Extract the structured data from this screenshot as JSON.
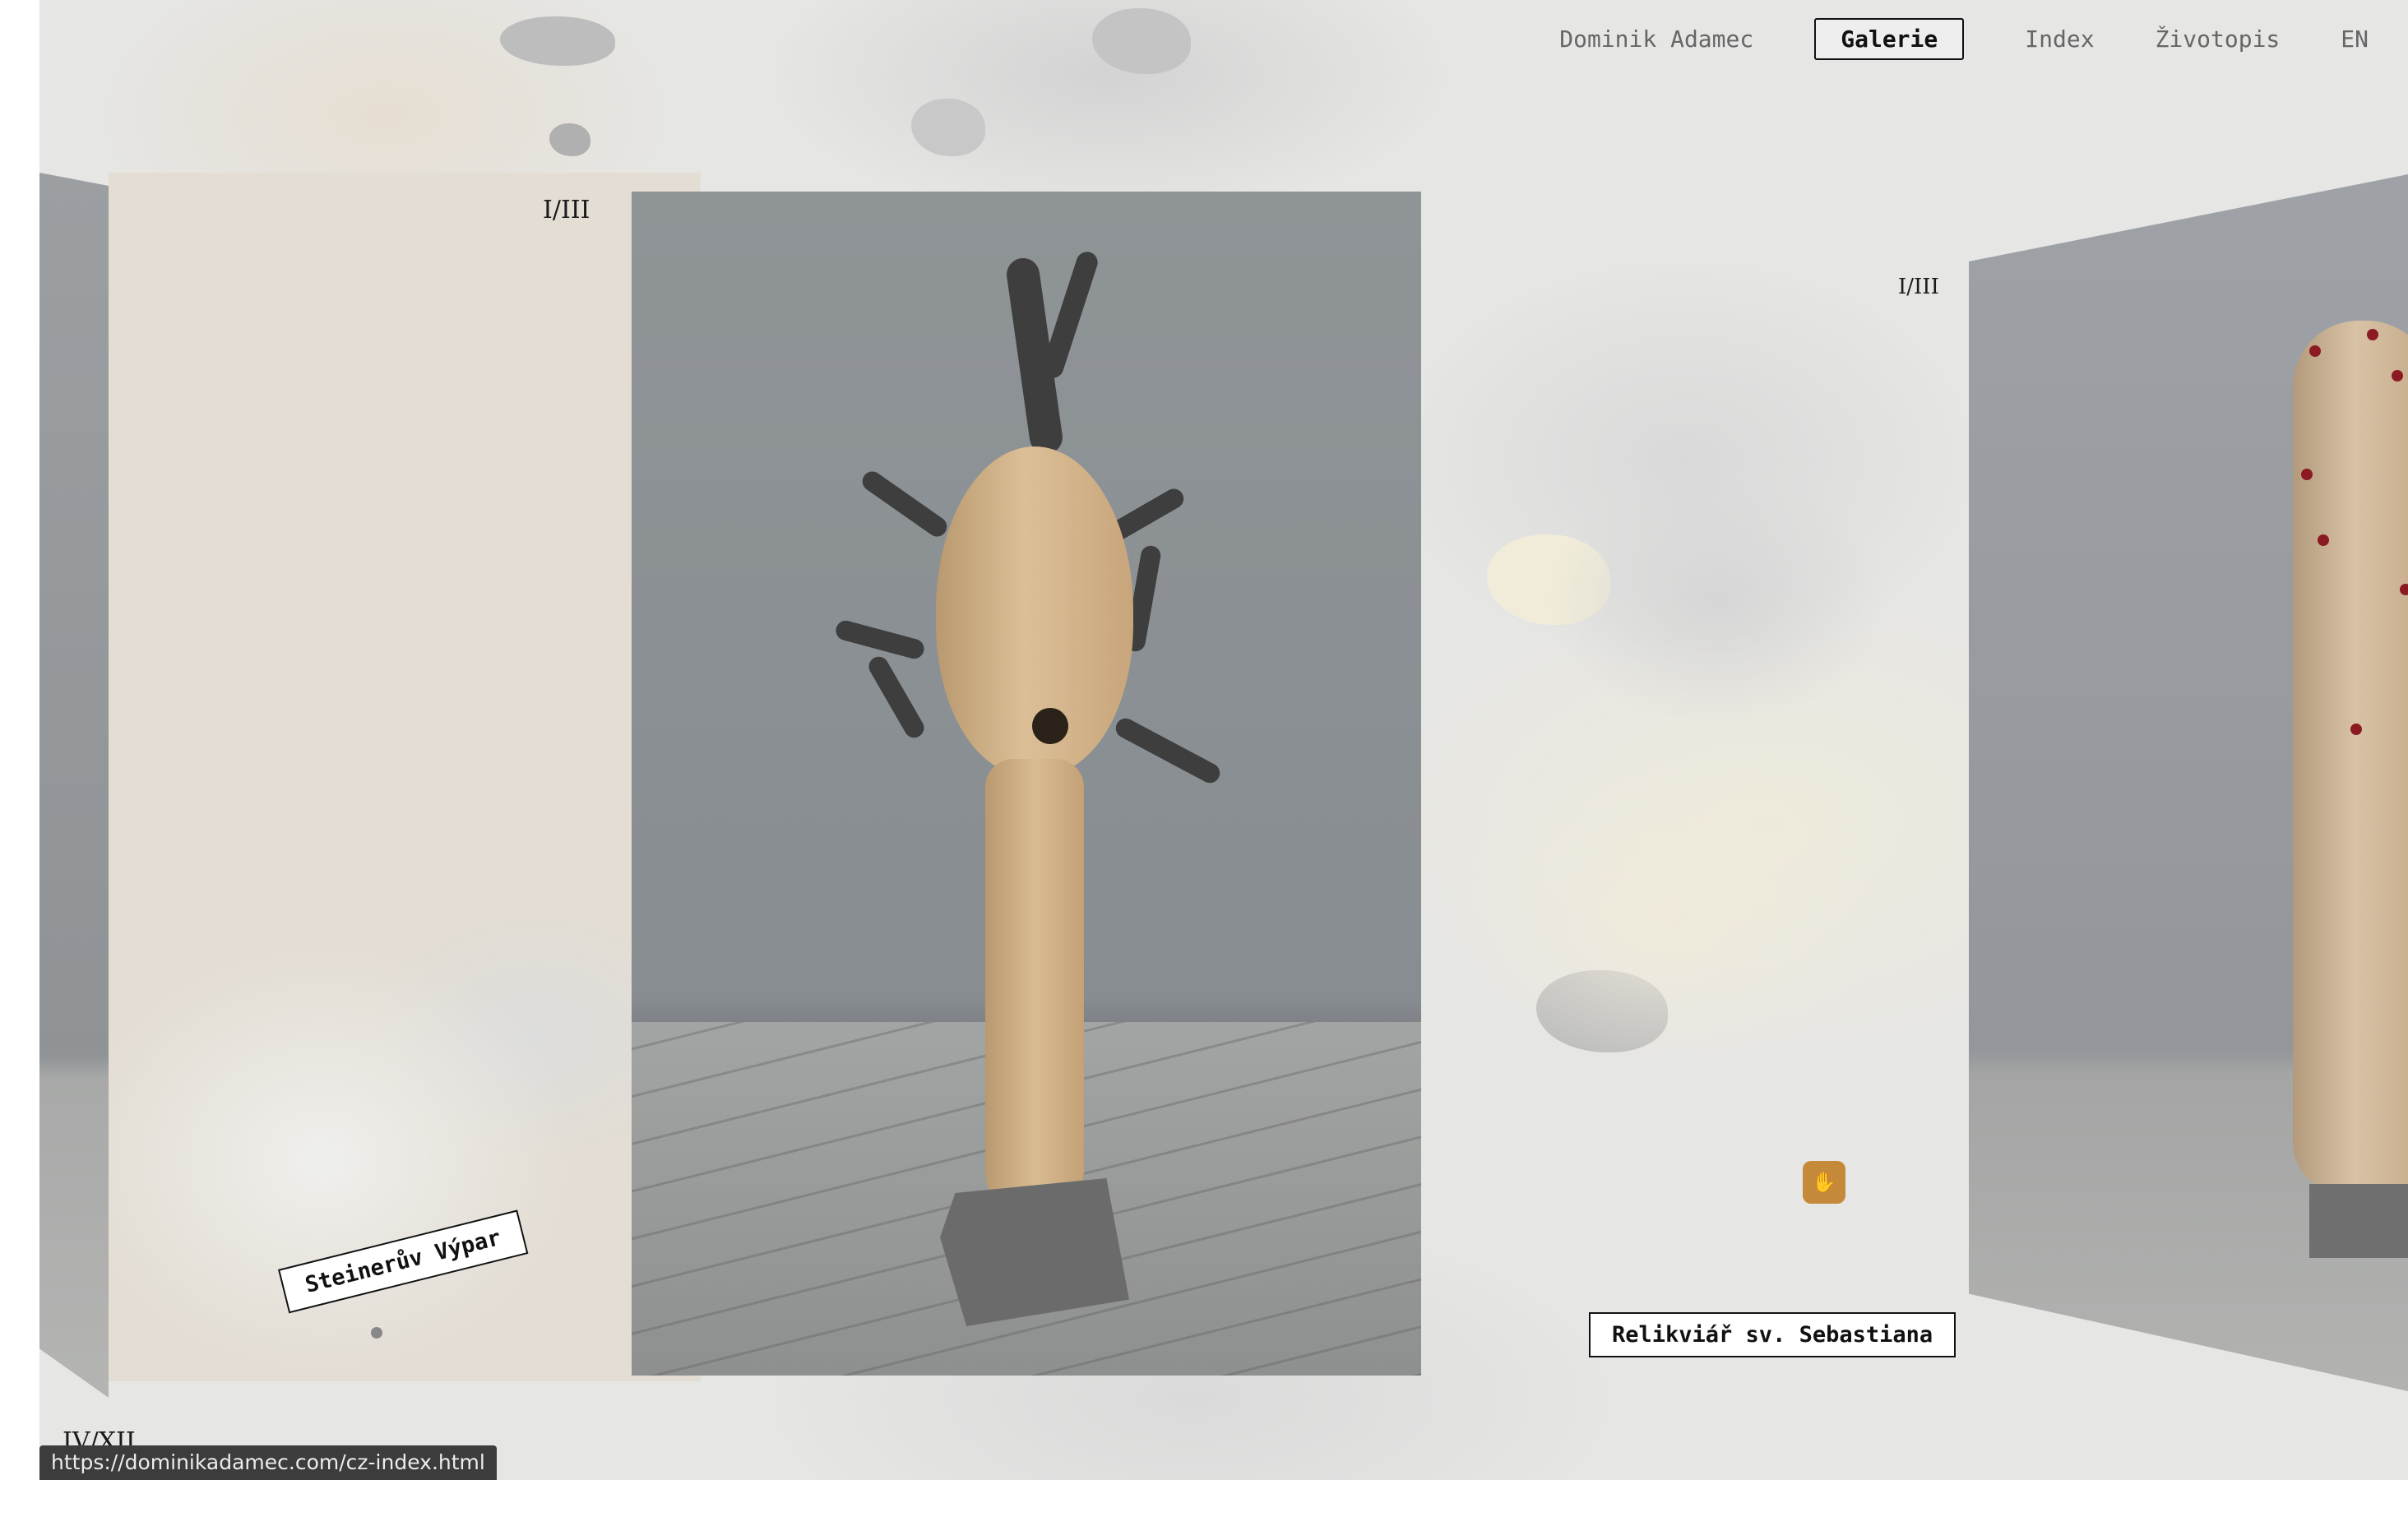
{
  "nav": {
    "artist_name": "Dominik Adamec",
    "items": [
      {
        "label": "Galerie",
        "active": true
      },
      {
        "label": "Index",
        "active": false
      },
      {
        "label": "Životopis",
        "active": false
      },
      {
        "label": "EN",
        "active": false
      }
    ]
  },
  "gallery": {
    "left_counter": "I/III",
    "right_counter": "I/III",
    "bottom_counter": "IV/XII",
    "left_title": "Steinerův Výpar",
    "right_title": "Relikviář sv. Sebastiana"
  },
  "status_bar": {
    "url": "https://dominikadamec.com/cz-index.html"
  },
  "colors": {
    "accent_badge": "#c48a3a",
    "text": "#111111",
    "nav_muted": "#666666"
  }
}
